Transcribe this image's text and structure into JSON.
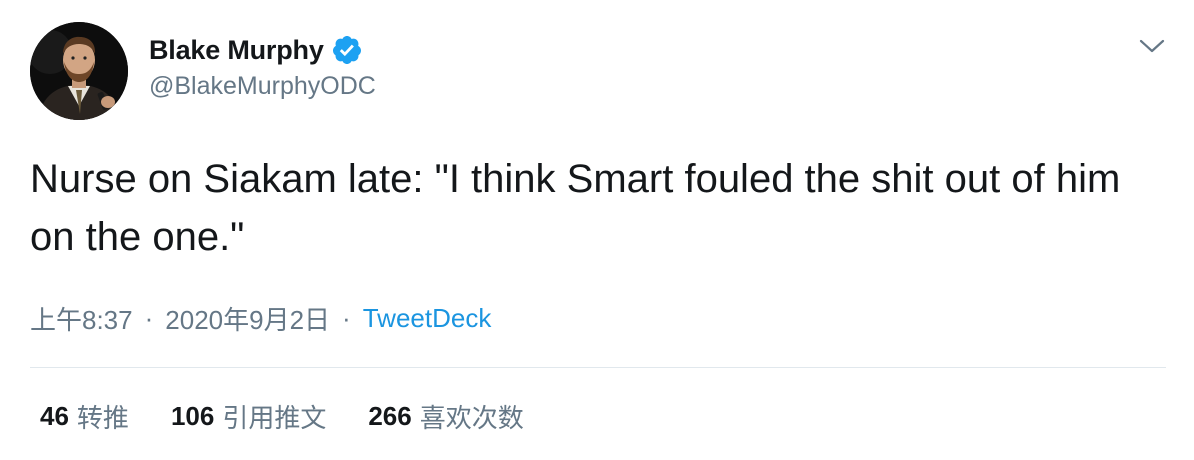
{
  "author": {
    "display_name": "Blake Murphy",
    "handle": "@BlakeMurphyODC",
    "verified": true,
    "avatar_icon": "profile-photo"
  },
  "tweet": {
    "text": "Nurse on Siakam late: \"I think Smart fouled the shit out of him on the one.\""
  },
  "meta": {
    "time": "上午8:37",
    "separator": "·",
    "date": "2020年9月2日",
    "source": "TweetDeck"
  },
  "stats": {
    "retweets": {
      "count": "46",
      "label": "转推"
    },
    "quotes": {
      "count": "106",
      "label": "引用推文"
    },
    "likes": {
      "count": "266",
      "label": "喜欢次数"
    }
  },
  "icons": {
    "verified": "verified-badge-icon",
    "menu": "chevron-down-icon"
  },
  "colors": {
    "text_primary": "#14171a",
    "text_secondary": "#657786",
    "link": "#1b95e0",
    "verified": "#1da1f2",
    "divider": "#e1e8ed"
  }
}
